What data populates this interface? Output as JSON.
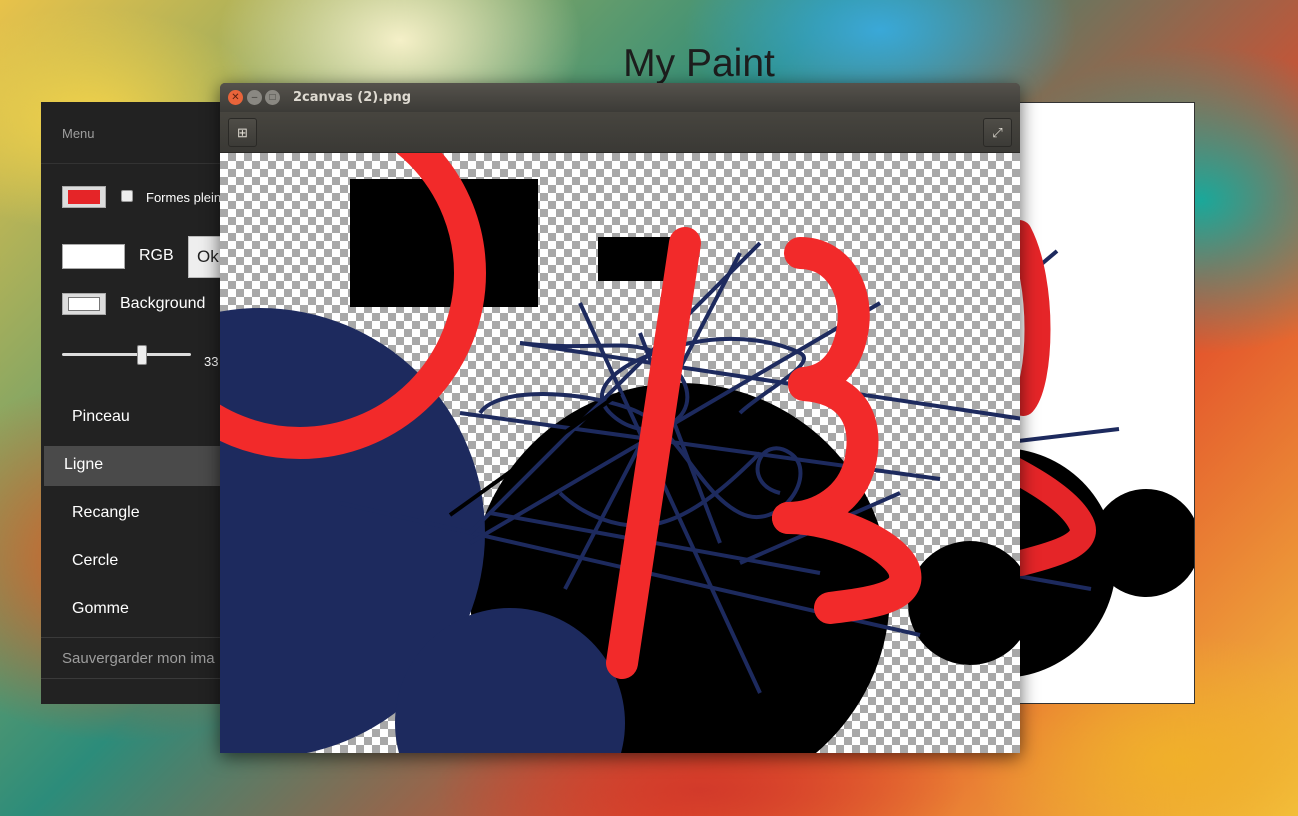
{
  "page": {
    "title": "My Paint"
  },
  "menu": {
    "header": "Menu",
    "filled_shapes_label": "Formes plein",
    "rgb_label": "RGB",
    "ok_label": "Ok",
    "background_label": "Background",
    "slider_value": "33",
    "slider_fraction": 0.62,
    "stroke_color": "#e52528",
    "tools": [
      {
        "label": "Pinceau",
        "active": false
      },
      {
        "label": "Ligne",
        "active": true
      },
      {
        "label": "Recangle",
        "active": false
      },
      {
        "label": "Cercle",
        "active": false
      },
      {
        "label": "Gomme",
        "active": false
      }
    ],
    "save_label": "Sauvergarder mon ima"
  },
  "viewer": {
    "title": "2canvas (2).png",
    "close_icon": "close-icon",
    "minimize_icon": "minimize-icon",
    "maximize_icon": "maximize-icon",
    "add_icon": "plus-icon",
    "fullscreen_icon": "fullscreen-icon"
  },
  "colors": {
    "paint_red": "#f22a2a",
    "paint_navy": "#1d2a5e",
    "paint_black": "#000000"
  }
}
